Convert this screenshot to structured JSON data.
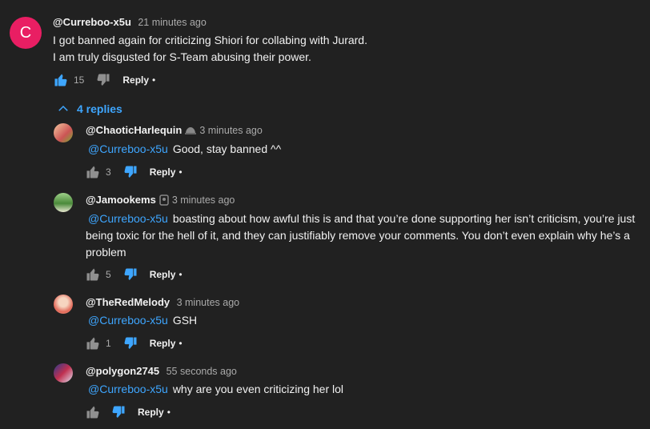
{
  "colors": {
    "background": "#212121",
    "accent": "#3ea6ff",
    "avatar_main": "#e91e63",
    "thumb_active": "#3ea6ff",
    "thumb_inactive": "#909090"
  },
  "main_comment": {
    "avatar_letter": "C",
    "username": "@Curreboo-x5u",
    "time": "21 minutes ago",
    "line1": "I got banned again for criticizing Shiori for collabing with Jurard.",
    "line2": "I am truly disgusted for S-Team abusing their power.",
    "likes": "15",
    "reply_label": "Reply",
    "dot": "•",
    "like_icon": "thumb-up-filled-icon",
    "dislike_icon": "thumb-down-icon"
  },
  "replies_toggle": {
    "label": "4 replies",
    "icon": "chevron-up-icon"
  },
  "replies": [
    {
      "username": "@ChaoticHarlequin",
      "badge_icon": "helmet-badge-icon",
      "time": "3 minutes ago",
      "mention": "@Curreboo-x5u",
      "text": "Good, stay banned ^^",
      "likes": "3",
      "reply_label": "Reply",
      "dot": "•"
    },
    {
      "username": "@Jamookems",
      "badge_icon": "membership-badge-icon",
      "time": "3 minutes ago",
      "mention": "@Curreboo-x5u",
      "text_line1": "boasting about how awful this is and that you’re done supporting her isn’t criticism, you’re just",
      "text_line2": "being toxic for the hell of it, and they can justifiably remove your comments. You don’t even explain why he’s a",
      "text_line3": "problem",
      "likes": "5",
      "reply_label": "Reply",
      "dot": "•"
    },
    {
      "username": "@TheRedMelody",
      "time": "3 minutes ago",
      "mention": "@Curreboo-x5u",
      "text": "GSH",
      "likes": "1",
      "reply_label": "Reply",
      "dot": "•"
    },
    {
      "username": "@polygon2745",
      "time": "55 seconds ago",
      "mention": "@Curreboo-x5u",
      "text": "why are you even criticizing her lol",
      "reply_label": "Reply",
      "dot": "•"
    }
  ]
}
